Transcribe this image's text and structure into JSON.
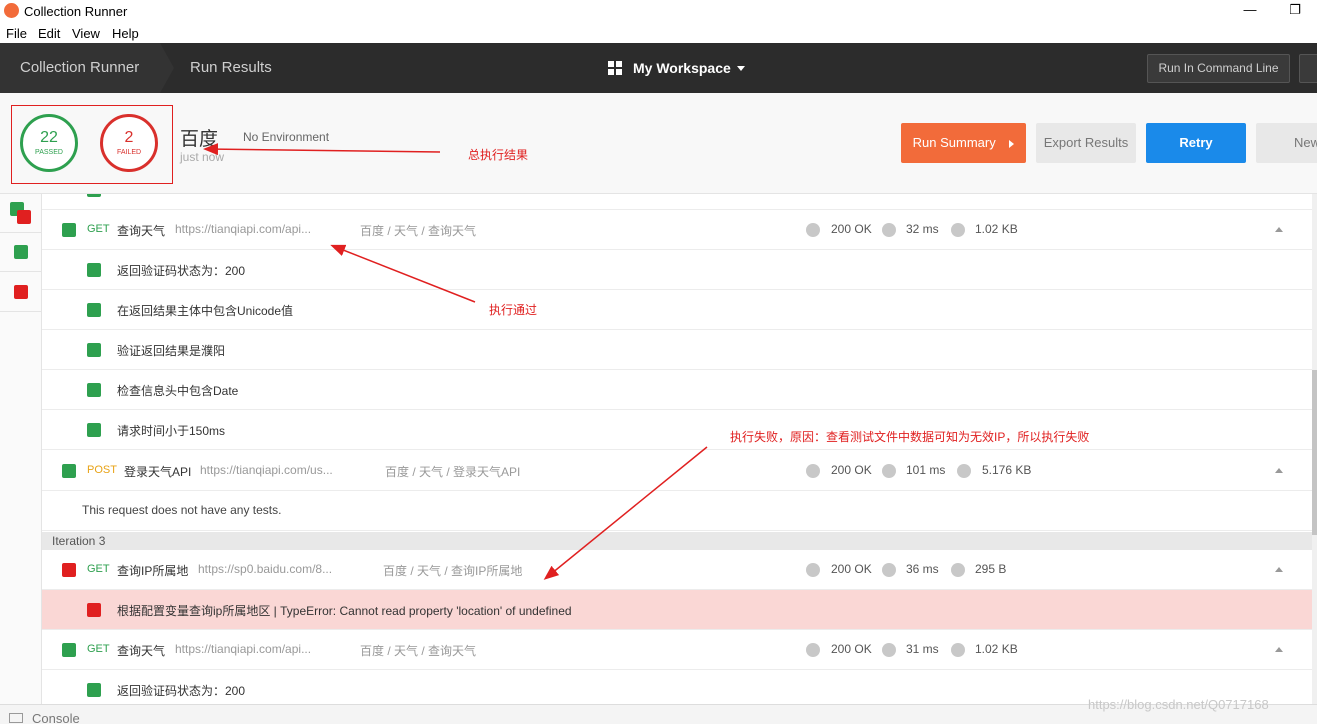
{
  "window": {
    "title": "Collection Runner",
    "minimize": "—",
    "maximize": "❐"
  },
  "menu": [
    "File",
    "Edit",
    "View",
    "Help"
  ],
  "nav": {
    "crumb1": "Collection Runner",
    "crumb2": "Run Results",
    "workspace": "My Workspace",
    "command_line": "Run In Command Line"
  },
  "summary": {
    "passed": "22",
    "passed_label": "PASSED",
    "failed": "2",
    "failed_label": "FAILED",
    "collection_name": "百度",
    "environment": "No Environment",
    "time": "just now",
    "run_summary": "Run Summary",
    "export": "Export Results",
    "retry": "Retry",
    "new": "New"
  },
  "annotations": {
    "total": "总执行结果",
    "pass": "执行通过",
    "fail": "执行失败，原因：查看测试文件中数据可知为无效IP，所以执行失败"
  },
  "rows": {
    "r1": {
      "method": "GET",
      "name": "查询天气",
      "url": "https://tianqiapi.com/api...",
      "path": "百度 / 天气 / 查询天气",
      "status": "200 OK",
      "time": "32 ms",
      "size": "1.02 KB"
    },
    "t1": "返回验证码状态为：200",
    "t2": "在返回结果主体中包含Unicode值",
    "t3": "验证返回结果是濮阳",
    "t4": "检查信息头中包含Date",
    "t5": "请求时间小于150ms",
    "r2": {
      "method": "POST",
      "name": "登录天气API",
      "url": "https://tianqiapi.com/us...",
      "path": "百度 / 天气 / 登录天气API",
      "status": "200 OK",
      "time": "101 ms",
      "size": "5.176 KB"
    },
    "no_tests": "This request does not have any tests.",
    "iteration": "Iteration 3",
    "r3": {
      "method": "GET",
      "name": "查询IP所属地",
      "url": "https://sp0.baidu.com/8...",
      "path": "百度 / 天气 / 查询IP所属地",
      "status": "200 OK",
      "time": "36 ms",
      "size": "295 B"
    },
    "fail_text": "根据配置变量查询ip所属地区 | TypeError: Cannot read property 'location' of undefined",
    "r4": {
      "method": "GET",
      "name": "查询天气",
      "url": "https://tianqiapi.com/api...",
      "path": "百度 / 天气 / 查询天气",
      "status": "200 OK",
      "time": "31 ms",
      "size": "1.02 KB"
    },
    "t6": "返回验证码状态为：200"
  },
  "console": "Console",
  "watermark": "https://blog.csdn.net/Q0717168",
  "colors": {
    "passed": "#2ea04f",
    "failed": "#d9302c",
    "accent": "#f26b3a",
    "retry": "#1a8aea",
    "annotation": "#e02020"
  }
}
